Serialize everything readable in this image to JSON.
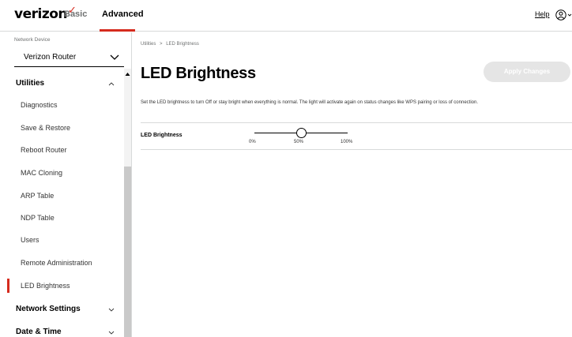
{
  "header": {
    "brand": "verizon",
    "brand_mark": "✓",
    "tabs": [
      "Basic",
      "Advanced"
    ],
    "active_tab": "Advanced",
    "help_label": "Help",
    "user_icon": "user-circle-icon"
  },
  "sidebar": {
    "network_device_label": "Network Device",
    "device_value": "Verizon Router",
    "sections": [
      {
        "label": "Utilities",
        "expanded": true,
        "items": [
          "Diagnostics",
          "Save & Restore",
          "Reboot Router",
          "MAC Cloning",
          "ARP Table",
          "NDP Table",
          "Users",
          "Remote Administration",
          "LED Brightness"
        ]
      },
      {
        "label": "Network Settings",
        "expanded": false
      },
      {
        "label": "Date & Time",
        "expanded": false
      }
    ],
    "active_item": "LED Brightness"
  },
  "main": {
    "breadcrumb": [
      "Utilities",
      "LED Brightness"
    ],
    "breadcrumb_separator": ">",
    "title": "LED Brightness",
    "apply_label": "Apply Changes",
    "description": "Set the LED brightness to turn Off or stay bright when everything is normal. The light will activate again on status changes like WPS pairing or loss of connection.",
    "setting": {
      "label": "LED Brightness",
      "ticks": [
        "0%",
        "50%",
        "100%"
      ],
      "value_percent": 50
    }
  },
  "colors": {
    "accent": "#d52b1e",
    "border": "#d8dada",
    "button_disabled": "#e5e5e5"
  }
}
